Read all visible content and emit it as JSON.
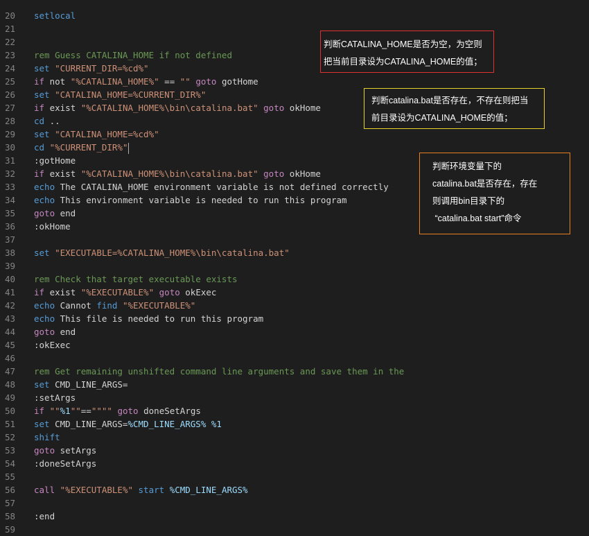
{
  "editor": {
    "lines": [
      {
        "n": "20",
        "tokens": [
          {
            "t": "setlocal",
            "c": "kw"
          }
        ]
      },
      {
        "n": "21",
        "tokens": []
      },
      {
        "n": "22",
        "tokens": []
      },
      {
        "n": "23",
        "tokens": [
          {
            "t": "rem Guess CATALINA_HOME if not defined",
            "c": "cmt"
          }
        ]
      },
      {
        "n": "24",
        "tokens": [
          {
            "t": "set",
            "c": "kw"
          },
          {
            "t": " ",
            "c": ""
          },
          {
            "t": "\"CURRENT_DIR=%cd%\"",
            "c": "str"
          }
        ]
      },
      {
        "n": "25",
        "tokens": [
          {
            "t": "if",
            "c": "ctl"
          },
          {
            "t": " not ",
            "c": ""
          },
          {
            "t": "\"%CATALINA_HOME%\"",
            "c": "str"
          },
          {
            "t": " == ",
            "c": ""
          },
          {
            "t": "\"\"",
            "c": "str"
          },
          {
            "t": " ",
            "c": ""
          },
          {
            "t": "goto",
            "c": "ctl"
          },
          {
            "t": " gotHome",
            "c": ""
          }
        ]
      },
      {
        "n": "26",
        "tokens": [
          {
            "t": "set",
            "c": "kw"
          },
          {
            "t": " ",
            "c": ""
          },
          {
            "t": "\"CATALINA_HOME=%CURRENT_DIR%\"",
            "c": "str"
          }
        ]
      },
      {
        "n": "27",
        "tokens": [
          {
            "t": "if",
            "c": "ctl"
          },
          {
            "t": " exist ",
            "c": ""
          },
          {
            "t": "\"%CATALINA_HOME%\\bin\\catalina.bat\"",
            "c": "str"
          },
          {
            "t": " ",
            "c": ""
          },
          {
            "t": "goto",
            "c": "ctl"
          },
          {
            "t": " okHome",
            "c": ""
          }
        ]
      },
      {
        "n": "28",
        "tokens": [
          {
            "t": "cd",
            "c": "kw"
          },
          {
            "t": " ..",
            "c": ""
          }
        ]
      },
      {
        "n": "29",
        "tokens": [
          {
            "t": "set",
            "c": "kw"
          },
          {
            "t": " ",
            "c": ""
          },
          {
            "t": "\"CATALINA_HOME=%cd%\"",
            "c": "str"
          }
        ]
      },
      {
        "n": "30",
        "tokens": [
          {
            "t": "cd",
            "c": "kw"
          },
          {
            "t": " ",
            "c": ""
          },
          {
            "t": "\"%CURRENT_DIR%\"",
            "c": "str"
          }
        ],
        "caret": true
      },
      {
        "n": "31",
        "tokens": [
          {
            "t": ":gotHome",
            "c": "lbl"
          }
        ]
      },
      {
        "n": "32",
        "tokens": [
          {
            "t": "if",
            "c": "ctl"
          },
          {
            "t": " exist ",
            "c": ""
          },
          {
            "t": "\"%CATALINA_HOME%\\bin\\catalina.bat\"",
            "c": "str"
          },
          {
            "t": " ",
            "c": ""
          },
          {
            "t": "goto",
            "c": "ctl"
          },
          {
            "t": " okHome",
            "c": ""
          }
        ]
      },
      {
        "n": "33",
        "tokens": [
          {
            "t": "echo",
            "c": "kw"
          },
          {
            "t": " The CATALINA_HOME environment variable is not defined correctly",
            "c": ""
          }
        ]
      },
      {
        "n": "34",
        "tokens": [
          {
            "t": "echo",
            "c": "kw"
          },
          {
            "t": " This environment variable is needed to run this program",
            "c": ""
          }
        ]
      },
      {
        "n": "35",
        "tokens": [
          {
            "t": "goto",
            "c": "ctl"
          },
          {
            "t": " end",
            "c": ""
          }
        ]
      },
      {
        "n": "36",
        "tokens": [
          {
            "t": ":okHome",
            "c": "lbl"
          }
        ]
      },
      {
        "n": "37",
        "tokens": []
      },
      {
        "n": "38",
        "tokens": [
          {
            "t": "set",
            "c": "kw"
          },
          {
            "t": " ",
            "c": ""
          },
          {
            "t": "\"EXECUTABLE=%CATALINA_HOME%\\bin\\catalina.bat\"",
            "c": "str"
          }
        ]
      },
      {
        "n": "39",
        "tokens": []
      },
      {
        "n": "40",
        "tokens": [
          {
            "t": "rem Check that target executable exists",
            "c": "cmt"
          }
        ]
      },
      {
        "n": "41",
        "tokens": [
          {
            "t": "if",
            "c": "ctl"
          },
          {
            "t": " exist ",
            "c": ""
          },
          {
            "t": "\"%EXECUTABLE%\"",
            "c": "str"
          },
          {
            "t": " ",
            "c": ""
          },
          {
            "t": "goto",
            "c": "ctl"
          },
          {
            "t": " okExec",
            "c": ""
          }
        ]
      },
      {
        "n": "42",
        "tokens": [
          {
            "t": "echo",
            "c": "kw"
          },
          {
            "t": " Cannot ",
            "c": ""
          },
          {
            "t": "find",
            "c": "kw"
          },
          {
            "t": " ",
            "c": ""
          },
          {
            "t": "\"%EXECUTABLE%\"",
            "c": "str"
          }
        ]
      },
      {
        "n": "43",
        "tokens": [
          {
            "t": "echo",
            "c": "kw"
          },
          {
            "t": " This file is needed to run this program",
            "c": ""
          }
        ]
      },
      {
        "n": "44",
        "tokens": [
          {
            "t": "goto",
            "c": "ctl"
          },
          {
            "t": " end",
            "c": ""
          }
        ]
      },
      {
        "n": "45",
        "tokens": [
          {
            "t": ":okExec",
            "c": "lbl"
          }
        ]
      },
      {
        "n": "46",
        "tokens": []
      },
      {
        "n": "47",
        "tokens": [
          {
            "t": "rem Get remaining unshifted command line arguments and save them in the",
            "c": "cmt"
          }
        ]
      },
      {
        "n": "48",
        "tokens": [
          {
            "t": "set",
            "c": "kw"
          },
          {
            "t": " CMD_LINE_ARGS=",
            "c": ""
          }
        ]
      },
      {
        "n": "49",
        "tokens": [
          {
            "t": ":setArgs",
            "c": "lbl"
          }
        ]
      },
      {
        "n": "50",
        "tokens": [
          {
            "t": "if",
            "c": "ctl"
          },
          {
            "t": " ",
            "c": ""
          },
          {
            "t": "\"\"",
            "c": "str"
          },
          {
            "t": "%1",
            "c": "var"
          },
          {
            "t": "\"\"",
            "c": "str"
          },
          {
            "t": "==",
            "c": ""
          },
          {
            "t": "\"\"\"\"",
            "c": "str"
          },
          {
            "t": " ",
            "c": ""
          },
          {
            "t": "goto",
            "c": "ctl"
          },
          {
            "t": " doneSetArgs",
            "c": ""
          }
        ]
      },
      {
        "n": "51",
        "tokens": [
          {
            "t": "set",
            "c": "kw"
          },
          {
            "t": " CMD_LINE_ARGS=",
            "c": ""
          },
          {
            "t": "%CMD_LINE_ARGS%",
            "c": "var"
          },
          {
            "t": " ",
            "c": ""
          },
          {
            "t": "%1",
            "c": "var"
          }
        ]
      },
      {
        "n": "52",
        "tokens": [
          {
            "t": "shift",
            "c": "kw"
          }
        ]
      },
      {
        "n": "53",
        "tokens": [
          {
            "t": "goto",
            "c": "ctl"
          },
          {
            "t": " setArgs",
            "c": ""
          }
        ]
      },
      {
        "n": "54",
        "tokens": [
          {
            "t": ":doneSetArgs",
            "c": "lbl"
          }
        ]
      },
      {
        "n": "55",
        "tokens": []
      },
      {
        "n": "56",
        "tokens": [
          {
            "t": "call",
            "c": "ctl"
          },
          {
            "t": " ",
            "c": ""
          },
          {
            "t": "\"%EXECUTABLE%\"",
            "c": "str"
          },
          {
            "t": " ",
            "c": ""
          },
          {
            "t": "start",
            "c": "kw"
          },
          {
            "t": " ",
            "c": ""
          },
          {
            "t": "%CMD_LINE_ARGS%",
            "c": "var"
          }
        ]
      },
      {
        "n": "57",
        "tokens": []
      },
      {
        "n": "58",
        "tokens": [
          {
            "t": ":end",
            "c": "lbl"
          }
        ]
      },
      {
        "n": "59",
        "tokens": []
      }
    ]
  },
  "notes": {
    "note1": {
      "lines": [
        "判断CATALINA_HOME是否为空，为空则",
        "把当前目录设为CATALINA_HOME的值；"
      ],
      "border_color": "#e03030"
    },
    "note2": {
      "lines": [
        "判断catalina.bat是否存在，不存在则把当",
        "前目录设为CATALINA_HOME的值；"
      ],
      "border_color": "#e6d42a"
    },
    "note3": {
      "lines": [
        "判断环境变量下的",
        "catalina.bat是否存在，存在",
        "则调用bin目录下的",
        " “catalina.bat start”命令"
      ],
      "border_color": "#e8801c"
    }
  }
}
